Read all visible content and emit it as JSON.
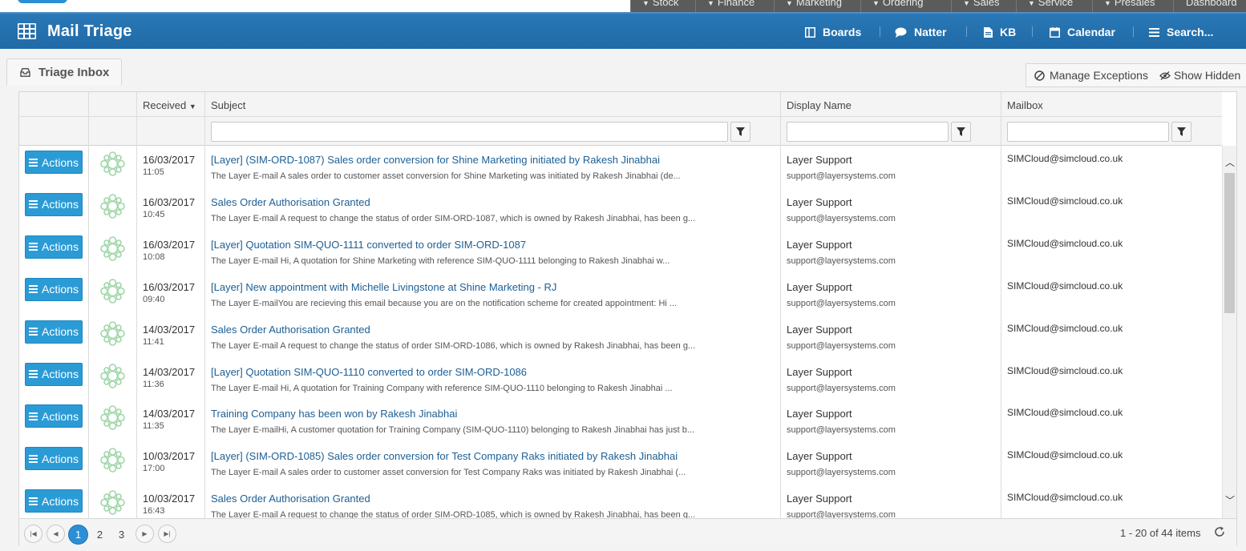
{
  "top_modules": [
    {
      "label": "Stock"
    },
    {
      "label": "Finance"
    },
    {
      "label": "Marketing"
    },
    {
      "label": "Ordering"
    },
    {
      "label": "Sales"
    },
    {
      "label": "Service"
    },
    {
      "label": "Presales"
    },
    {
      "label": "Dashboard"
    }
  ],
  "header": {
    "app_title": "Mail Triage",
    "nav": {
      "boards": "Boards",
      "natter": "Natter",
      "kb": "KB",
      "calendar": "Calendar",
      "search": "Search..."
    }
  },
  "tab": {
    "label": "Triage Inbox"
  },
  "tools": {
    "manage_exceptions": "Manage Exceptions",
    "show_hidden": "Show Hidden"
  },
  "grid": {
    "columns": {
      "received": "Received",
      "subject": "Subject",
      "display_name": "Display Name",
      "mailbox": "Mailbox"
    },
    "sort_indicator": "▼",
    "actions_label": "Actions",
    "rows": [
      {
        "date": "16/03/2017",
        "time": "11:05",
        "subject": "[Layer] (SIM-ORD-1087) Sales order conversion for Shine Marketing initiated by Rakesh Jinabhai",
        "preview": "The Layer E-mail A sales order to customer asset conversion for Shine Marketing was initiated by Rakesh Jinabhai (de...",
        "display_name": "Layer Support",
        "email": "support@layersystems.com",
        "mailbox": "SIMCloud@simcloud.co.uk"
      },
      {
        "date": "16/03/2017",
        "time": "10:45",
        "subject": "Sales Order Authorisation Granted",
        "preview": "The Layer E-mail A request to change the status of order SIM-ORD-1087, which is owned by Rakesh Jinabhai, has been g...",
        "display_name": "Layer Support",
        "email": "support@layersystems.com",
        "mailbox": "SIMCloud@simcloud.co.uk"
      },
      {
        "date": "16/03/2017",
        "time": "10:08",
        "subject": "[Layer] Quotation SIM-QUO-1111 converted to order SIM-ORD-1087",
        "preview": "The Layer E-mail Hi, A quotation for Shine Marketing with reference SIM-QUO-1111 belonging to Rakesh Jinabhai w...",
        "display_name": "Layer Support",
        "email": "support@layersystems.com",
        "mailbox": "SIMCloud@simcloud.co.uk"
      },
      {
        "date": "16/03/2017",
        "time": "09:40",
        "subject": "[Layer] New appointment with Michelle Livingstone at Shine Marketing - RJ",
        "preview": "The Layer E-mailYou are recieving this email because you are on the notification scheme for created appointment: Hi ...",
        "display_name": "Layer Support",
        "email": "support@layersystems.com",
        "mailbox": "SIMCloud@simcloud.co.uk"
      },
      {
        "date": "14/03/2017",
        "time": "11:41",
        "subject": "Sales Order Authorisation Granted",
        "preview": "The Layer E-mail A request to change the status of order SIM-ORD-1086, which is owned by Rakesh Jinabhai, has been g...",
        "display_name": "Layer Support",
        "email": "support@layersystems.com",
        "mailbox": "SIMCloud@simcloud.co.uk"
      },
      {
        "date": "14/03/2017",
        "time": "11:36",
        "subject": "[Layer] Quotation SIM-QUO-1110 converted to order SIM-ORD-1086",
        "preview": "The Layer E-mail Hi, A quotation for Training Company with reference SIM-QUO-1110 belonging to Rakesh Jinabhai ...",
        "display_name": "Layer Support",
        "email": "support@layersystems.com",
        "mailbox": "SIMCloud@simcloud.co.uk"
      },
      {
        "date": "14/03/2017",
        "time": "11:35",
        "subject": "Training Company has been won by Rakesh Jinabhai",
        "preview": "The Layer E-mailHi, A customer quotation for Training Company (SIM-QUO-1110) belonging to Rakesh Jinabhai has just b...",
        "display_name": "Layer Support",
        "email": "support@layersystems.com",
        "mailbox": "SIMCloud@simcloud.co.uk"
      },
      {
        "date": "10/03/2017",
        "time": "17:00",
        "subject": "[Layer] (SIM-ORD-1085) Sales order conversion for Test Company Raks initiated by Rakesh Jinabhai",
        "preview": "The Layer E-mail A sales order to customer asset conversion for Test Company Raks was initiated by Rakesh Jinabhai (...",
        "display_name": "Layer Support",
        "email": "support@layersystems.com",
        "mailbox": "SIMCloud@simcloud.co.uk"
      },
      {
        "date": "10/03/2017",
        "time": "16:43",
        "subject": "Sales Order Authorisation Granted",
        "preview": "The Layer E-mail A request to change the status of order SIM-ORD-1085, which is owned by Rakesh Jinabhai, has been g...",
        "display_name": "Layer Support",
        "email": "support@layersystems.com",
        "mailbox": "SIMCloud@simcloud.co.uk"
      }
    ]
  },
  "pager": {
    "pages": [
      "1",
      "2",
      "3"
    ],
    "info": "1 - 20 of 44 items"
  },
  "colors": {
    "brand": "#1f6aa7",
    "accent": "#2b9bd6",
    "link": "#1c5f95"
  }
}
